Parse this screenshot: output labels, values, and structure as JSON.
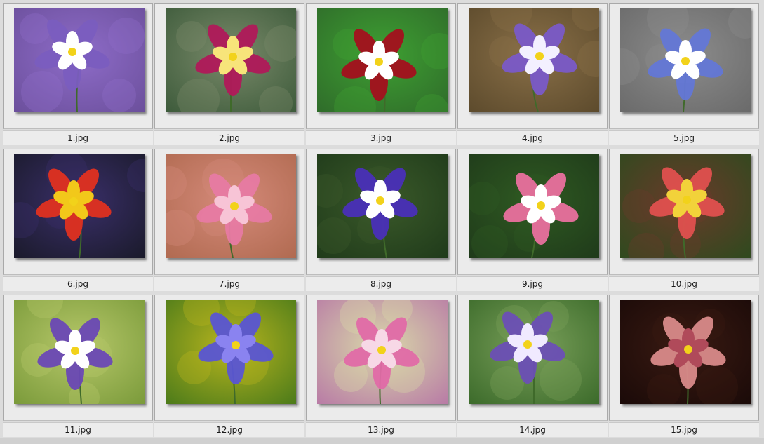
{
  "gallery": {
    "items": [
      {
        "filename": "1.jpg",
        "subject": "purple-white-columbine-icon",
        "bg": "#6b4f9b",
        "accent": "#8e6cc9",
        "petal": "#7a5dbf",
        "inner": "#ffffff"
      },
      {
        "filename": "2.jpg",
        "subject": "magenta-yellow-columbine-icon",
        "bg": "#3c5a3a",
        "accent": "#7a8a6a",
        "petal": "#b0195a",
        "inner": "#f7e47a"
      },
      {
        "filename": "3.jpg",
        "subject": "red-white-columbine-icon",
        "bg": "#2f6b2a",
        "accent": "#3ea032",
        "petal": "#a3101e",
        "inner": "#ffffff"
      },
      {
        "filename": "4.jpg",
        "subject": "violet-columbine-cluster-icon",
        "bg": "#5c4a2c",
        "accent": "#8a7048",
        "petal": "#7a5ac8",
        "inner": "#f3f0ff"
      },
      {
        "filename": "5.jpg",
        "subject": "blue-white-columbine-pair-icon",
        "bg": "#6a6a6a",
        "accent": "#8c8c8c",
        "petal": "#6377d6",
        "inner": "#ffffff"
      },
      {
        "filename": "6.jpg",
        "subject": "yellow-red-columbine-icon",
        "bg": "#1a1a2a",
        "accent": "#3a2f6a",
        "petal": "#e03020",
        "inner": "#f2c81a"
      },
      {
        "filename": "7.jpg",
        "subject": "pink-columbine-icon",
        "bg": "#b06a50",
        "accent": "#d58a7a",
        "petal": "#e77aa3",
        "inner": "#f7c4d6"
      },
      {
        "filename": "8.jpg",
        "subject": "indigo-white-columbine-icon",
        "bg": "#1f3a1a",
        "accent": "#3b5a2a",
        "petal": "#4a2fb8",
        "inner": "#ffffff"
      },
      {
        "filename": "9.jpg",
        "subject": "pink-white-columbine-icon",
        "bg": "#1f3a1a",
        "accent": "#2f5a22",
        "petal": "#e9709e",
        "inner": "#ffffff"
      },
      {
        "filename": "10.jpg",
        "subject": "coral-yellow-columbine-icon",
        "bg": "#2e4a1e",
        "accent": "#6a3a2a",
        "petal": "#e0504e",
        "inner": "#f2d23a"
      },
      {
        "filename": "11.jpg",
        "subject": "purple-fern-columbine-icon",
        "bg": "#7a9a3a",
        "accent": "#b7c86a",
        "petal": "#6a48b5",
        "inner": "#ffffff"
      },
      {
        "filename": "12.jpg",
        "subject": "blue-violet-columbine-icon",
        "bg": "#4a7a1a",
        "accent": "#b9b51e",
        "petal": "#5a55d3",
        "inner": "#8a83f0"
      },
      {
        "filename": "13.jpg",
        "subject": "soft-pink-columbine-icon",
        "bg": "#b87aa6",
        "accent": "#d9d9a8",
        "petal": "#e06aa6",
        "inner": "#f7d8e6"
      },
      {
        "filename": "14.jpg",
        "subject": "purple-columbine-meadow-icon",
        "bg": "#3b6a2a",
        "accent": "#7aa05a",
        "petal": "#6b4fb5",
        "inner": "#f0eaff"
      },
      {
        "filename": "15.jpg",
        "subject": "translucent-pink-columbine-icon",
        "bg": "#1a0a08",
        "accent": "#3a1a12",
        "petal": "#d98a8a",
        "inner": "#b04a5a"
      }
    ]
  }
}
